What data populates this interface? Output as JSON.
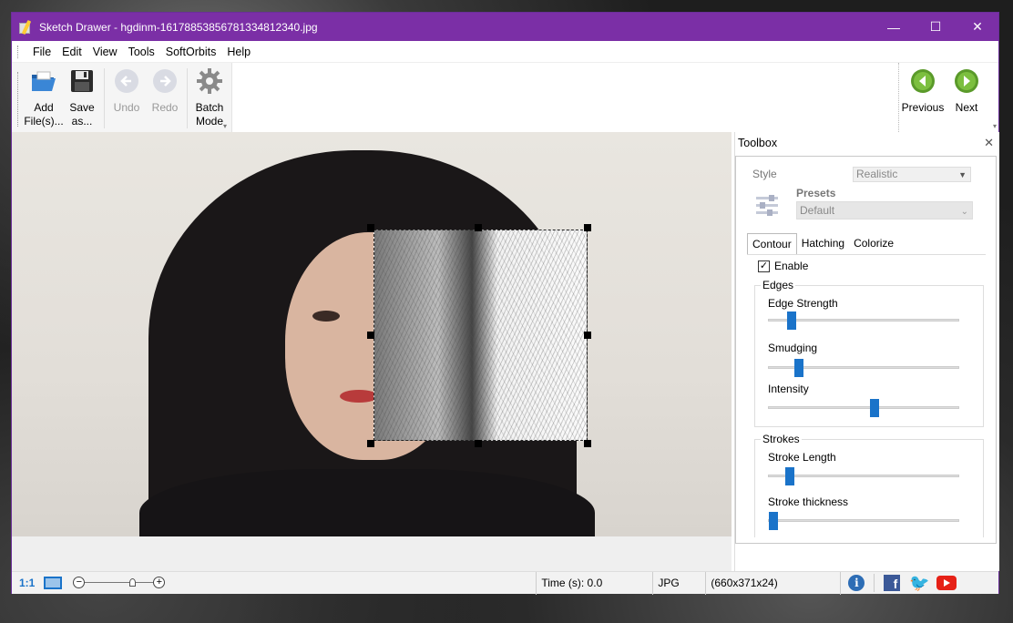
{
  "window": {
    "title": "Sketch Drawer - hgdinm-1617885385678133481 2340.jpg",
    "controls": [
      "minimize",
      "maximize",
      "close"
    ]
  },
  "menu": [
    "File",
    "Edit",
    "View",
    "Tools",
    "SoftOrbits",
    "Help"
  ],
  "toolbar": {
    "add_files": {
      "line1": "Add",
      "line2": "File(s)..."
    },
    "save_as": {
      "line1": "Save",
      "line2": "as..."
    },
    "undo": "Undo",
    "redo": "Redo",
    "batch_mode": {
      "line1": "Batch",
      "line2": "Mode"
    },
    "previous": "Previous",
    "next": "Next"
  },
  "toolbox": {
    "title": "Toolbox",
    "style_label": "Style",
    "style_value": "Realistic",
    "presets_label": "Presets",
    "presets_value": "Default",
    "tabs": [
      "Contour",
      "Hatching",
      "Colorize"
    ],
    "active_tab": "Contour",
    "enable_label": "Enable",
    "enable_checked": true,
    "edges": {
      "legend": "Edges",
      "sliders": [
        {
          "label": "Edge Strength",
          "value": 0.1
        },
        {
          "label": "Smudging",
          "value": 0.14
        },
        {
          "label": "Intensity",
          "value": 0.56
        }
      ]
    },
    "strokes": {
      "legend": "Strokes",
      "sliders": [
        {
          "label": "Stroke Length",
          "value": 0.09
        },
        {
          "label": "Stroke thickness",
          "value": 0.0
        }
      ]
    }
  },
  "status": {
    "zoom_actual": "1:1",
    "time": "Time (s): 0.0",
    "format": "JPG",
    "dimensions": "(660x371x24)"
  },
  "colors": {
    "titlebar": "#7b2fa6",
    "accent": "#1a73c9",
    "nav_green": "#5a9a2a"
  }
}
